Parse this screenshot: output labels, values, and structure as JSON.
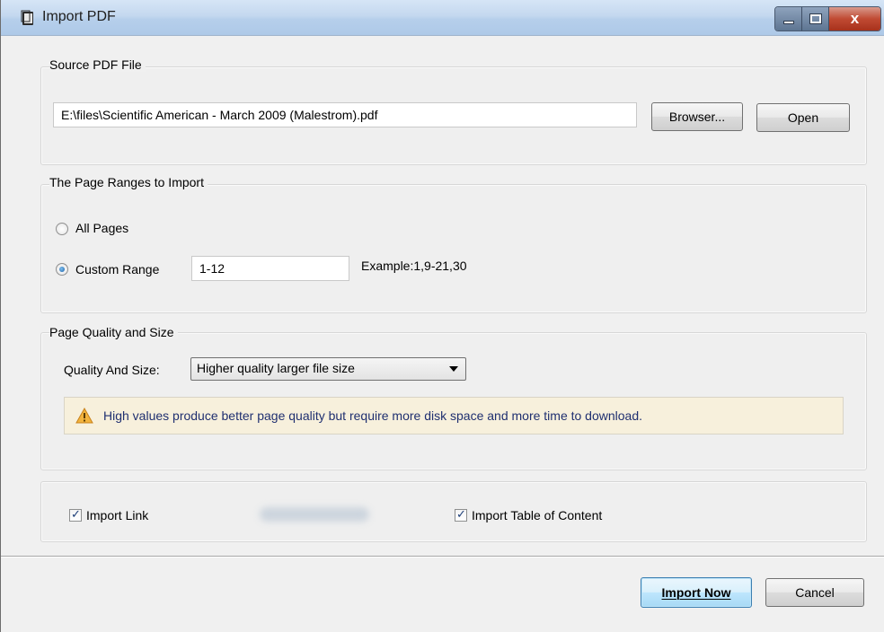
{
  "window": {
    "title": "Import PDF",
    "controls": {
      "minimize": "minimize",
      "maximize": "maximize",
      "close": "x"
    }
  },
  "source": {
    "group_label": "Source PDF File",
    "path_value": "E:\\files\\Scientific American - March 2009 (Malestrom).pdf",
    "browse_label": "Browser...",
    "open_label": "Open"
  },
  "ranges": {
    "group_label": "The Page Ranges to Import",
    "all_pages_label": "All Pages",
    "all_pages_checked": false,
    "custom_range_label": "Custom Range",
    "custom_range_checked": true,
    "custom_range_value": "1-12",
    "example_text": "Example:1,9-21,30"
  },
  "quality": {
    "group_label": "Page Quality and Size",
    "field_label": "Quality And Size:",
    "selected_option": "Higher quality larger file size",
    "warning_text": "High values produce better page quality but require more disk space and more time to download."
  },
  "options": {
    "import_link_label": "Import Link",
    "import_link_checked": true,
    "import_toc_label": "Import Table of Content",
    "import_toc_checked": true
  },
  "footer": {
    "import_now_label": "Import Now",
    "cancel_label": "Cancel"
  },
  "colors": {
    "warning_text": "#1f2f70",
    "warning_bg": "#f7f0dc",
    "titlebar": "#c4d8ef"
  }
}
